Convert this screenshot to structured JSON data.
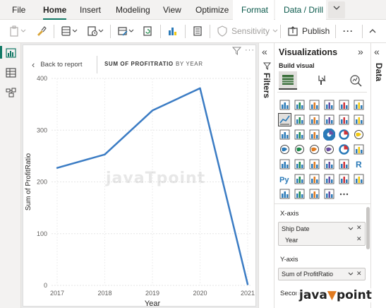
{
  "ribbon": {
    "tabs": [
      {
        "label": "File"
      },
      {
        "label": "Home"
      },
      {
        "label": "Insert"
      },
      {
        "label": "Modeling"
      },
      {
        "label": "View"
      },
      {
        "label": "Optimize"
      },
      {
        "label": "Format"
      },
      {
        "label": "Data / Drill"
      }
    ],
    "active_tab": "Home",
    "highlighted_tabs": [
      "Format",
      "Data / Drill"
    ]
  },
  "toolbar": {
    "sensitivity_label": "Sensitivity",
    "publish_label": "Publish",
    "more_label": "···"
  },
  "visual": {
    "back_label": "Back to report",
    "drill_title": "SUM OF PROFITRATIO",
    "drill_level": "BY YEAR",
    "more_label": "···"
  },
  "chart_data": {
    "type": "line",
    "x": [
      "2017",
      "2018",
      "2019",
      "2020",
      "2021"
    ],
    "series": [
      {
        "values": [
          227,
          253,
          338,
          381,
          2
        ]
      }
    ],
    "xlabel": "Year",
    "ylabel": "Sum of ProfitRatio",
    "yticks": [
      "0",
      "100",
      "200",
      "300",
      "400"
    ],
    "ylim": [
      0,
      400
    ],
    "grid": true,
    "line_color": "#3b7cc4"
  },
  "filters_pane": {
    "label": "Filters"
  },
  "data_pane": {
    "label": "Data"
  },
  "visualizations": {
    "title": "Visualizations",
    "build_visual_label": "Build visual",
    "x_axis_label": "X-axis",
    "x_axis_fields": [
      "Ship Date",
      "Year"
    ],
    "y_axis_label": "Y-axis",
    "y_axis_fields": [
      "Sum of ProfitRatio"
    ],
    "secondary_label": "Seconda"
  },
  "watermark": {
    "center_text": "javaTpoint",
    "corner_text_a": "java",
    "corner_text_b": "point"
  },
  "colors": {
    "accent": "#117865",
    "line": "#3b7cc4",
    "ribbon_bg": "#f3f2f1"
  }
}
